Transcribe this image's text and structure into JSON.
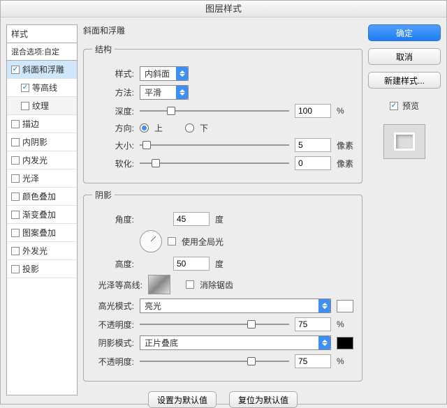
{
  "window": {
    "title": "图层样式"
  },
  "sidebar": {
    "header": "样式",
    "blend": "混合选项:自定",
    "items": [
      {
        "label": "斜面和浮雕",
        "checked": true,
        "selected": true
      },
      {
        "label": "等高线",
        "checked": true,
        "sub": true
      },
      {
        "label": "纹理",
        "checked": false,
        "sub": true,
        "pale": true
      },
      {
        "label": "描边",
        "checked": false
      },
      {
        "label": "内阴影",
        "checked": false
      },
      {
        "label": "内发光",
        "checked": false
      },
      {
        "label": "光泽",
        "checked": false
      },
      {
        "label": "颜色叠加",
        "checked": false
      },
      {
        "label": "渐变叠加",
        "checked": false
      },
      {
        "label": "图案叠加",
        "checked": false
      },
      {
        "label": "外发光",
        "checked": false
      },
      {
        "label": "投影",
        "checked": false
      }
    ]
  },
  "panel": {
    "title": "斜面和浮雕",
    "structure": {
      "legend": "结构",
      "style_lbl": "样式:",
      "style_val": "内斜面",
      "tech_lbl": "方法:",
      "tech_val": "平滑",
      "depth_lbl": "深度:",
      "depth_val": "100",
      "depth_unit": "%",
      "dir_lbl": "方向:",
      "dir_up": "上",
      "dir_down": "下",
      "size_lbl": "大小:",
      "size_val": "5",
      "size_unit": "像素",
      "soften_lbl": "软化:",
      "soften_val": "0",
      "soften_unit": "像素"
    },
    "shading": {
      "legend": "阴影",
      "angle_lbl": "角度:",
      "angle_val": "45",
      "angle_unit": "度",
      "global_lbl": "使用全局光",
      "alt_lbl": "高度:",
      "alt_val": "50",
      "alt_unit": "度",
      "gloss_lbl": "光泽等高线:",
      "aa_lbl": "消除锯齿",
      "hi_mode_lbl": "高光模式:",
      "hi_mode_val": "亮光",
      "hi_op_lbl": "不透明度:",
      "hi_op_val": "75",
      "hi_op_unit": "%",
      "sh_mode_lbl": "阴影模式:",
      "sh_mode_val": "正片叠底",
      "sh_op_lbl": "不透明度:",
      "sh_op_val": "75",
      "sh_op_unit": "%"
    },
    "defaults": {
      "set": "设置为默认值",
      "reset": "复位为默认值"
    }
  },
  "right": {
    "ok": "确定",
    "cancel": "取消",
    "newstyle": "新建样式...",
    "preview": "预览"
  }
}
